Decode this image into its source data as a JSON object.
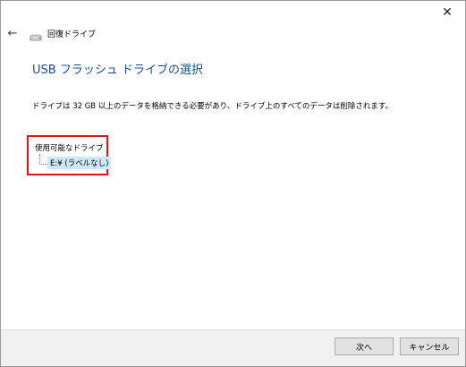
{
  "window": {
    "close_glyph": "✕"
  },
  "nav": {
    "back_glyph": "←",
    "title": "回復ドライブ"
  },
  "page": {
    "title": "USB フラッシュ ドライブの選択",
    "description": "ドライブは 32 GB 以上のデータを格納できる必要があり、ドライブ上のすべてのデータは削除されます。"
  },
  "drives": {
    "group_label": "使用可能なドライブ",
    "items": [
      {
        "label": "E:¥ (ラベルなし)"
      }
    ]
  },
  "footer": {
    "next_label": "次へ",
    "cancel_label": "キャンセル"
  },
  "colors": {
    "title": "#1a4f8f",
    "highlight_border": "#e0141e",
    "selection": "#cde8fb"
  }
}
